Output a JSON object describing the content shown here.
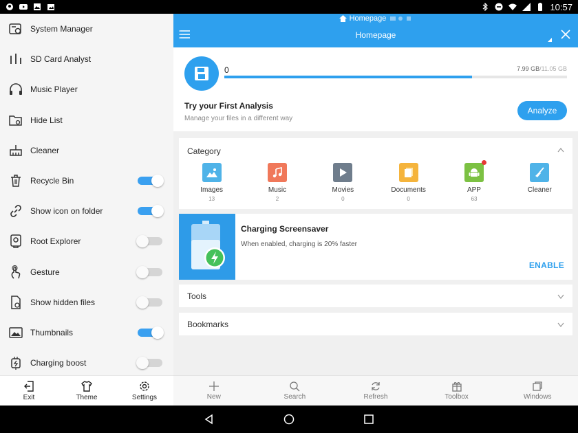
{
  "status_bar": {
    "time": "10:57"
  },
  "drawer": {
    "items": [
      {
        "label": "System Manager",
        "icon": "system-manager-icon"
      },
      {
        "label": "SD Card Analyst",
        "icon": "sd-card-analyst-icon"
      },
      {
        "label": "Music Player",
        "icon": "headphones-icon"
      },
      {
        "label": "Hide List",
        "icon": "hide-list-folder-icon"
      },
      {
        "label": "Cleaner",
        "icon": "broom-icon"
      },
      {
        "label": "Recycle Bin",
        "icon": "trash-icon",
        "toggle": true
      },
      {
        "label": "Show icon on folder",
        "icon": "link-icon",
        "toggle": true
      },
      {
        "label": "Root Explorer",
        "icon": "root-explorer-icon",
        "toggle": false
      },
      {
        "label": "Gesture",
        "icon": "gesture-icon",
        "toggle": false
      },
      {
        "label": "Show hidden files",
        "icon": "hidden-file-icon",
        "toggle": false
      },
      {
        "label": "Thumbnails",
        "icon": "image-icon",
        "toggle": true
      },
      {
        "label": "Charging boost",
        "icon": "plug-icon",
        "toggle": false
      }
    ],
    "bottom": {
      "exit": "Exit",
      "theme": "Theme",
      "settings": "Settings"
    }
  },
  "appbar": {
    "path_title": "Homepage",
    "title": "Homepage"
  },
  "storage": {
    "count": "0",
    "used": "7.99 GB",
    "total": "/11.05 GB",
    "used_fraction": 0.723,
    "heading": "Try your First Analysis",
    "subtitle": "Manage your files in a different way",
    "analyze_label": "Analyze"
  },
  "category": {
    "heading": "Category",
    "items": [
      {
        "name": "Images",
        "count": "13",
        "color": "#4fb3e8"
      },
      {
        "name": "Music",
        "count": "2",
        "color": "#f0785a"
      },
      {
        "name": "Movies",
        "count": "0",
        "color": "#6f7d8c"
      },
      {
        "name": "Documents",
        "count": "0",
        "color": "#f5b43c"
      },
      {
        "name": "APP",
        "count": "63",
        "color": "#7cc143"
      },
      {
        "name": "Cleaner",
        "count": "",
        "color": "#4fb3e8"
      }
    ]
  },
  "charging": {
    "heading": "Charging Screensaver",
    "subtitle": "When enabled, charging is 20% faster",
    "enable_label": "ENABLE"
  },
  "tools": {
    "heading": "Tools"
  },
  "bookmarks": {
    "heading": "Bookmarks"
  },
  "bottom_nav": {
    "new": "New",
    "search": "Search",
    "refresh": "Refresh",
    "toolbox": "Toolbox",
    "windows": "Windows"
  },
  "colors": {
    "accent": "#2ea0ee",
    "toggle_on": "#3aa0f0"
  }
}
